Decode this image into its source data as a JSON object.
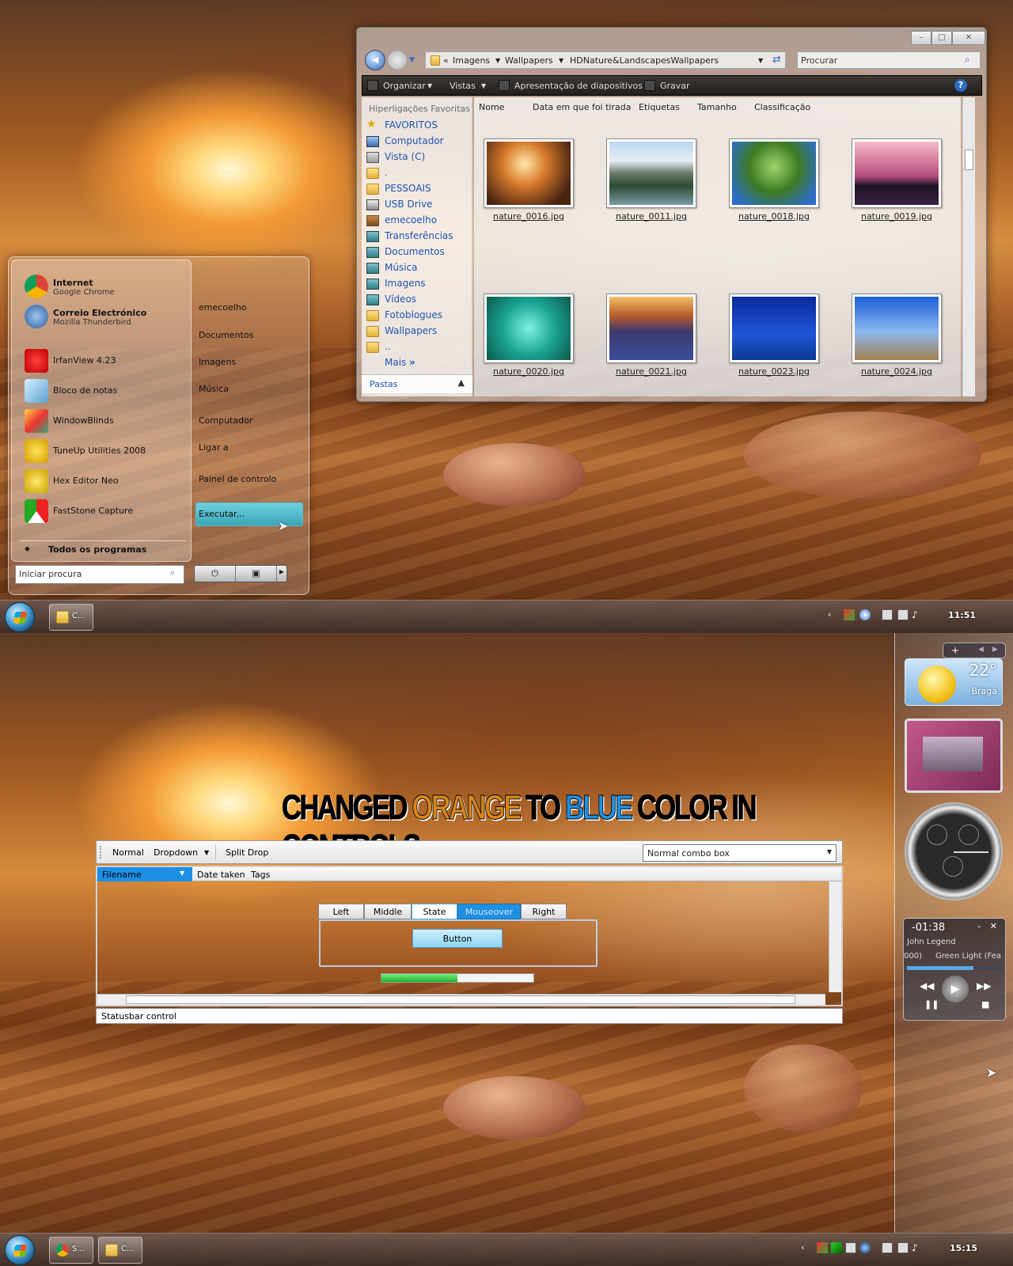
{
  "top": {
    "explorer": {
      "breadcrumb": [
        "Imagens",
        "Wallpapers",
        "HDNature&LandscapesWallpapers"
      ],
      "search_placeholder": "Procurar",
      "toolbar": {
        "organize": "Organizar",
        "views": "Vistas",
        "slideshow": "Apresentação de diapositivos",
        "burn": "Gravar"
      },
      "nav_header": "Hiperligações Favoritas",
      "nav_items": [
        "FAVORITOS",
        "Computador",
        "Vista (C)",
        ".",
        "PESSOAIS",
        "USB Drive",
        "emecoelho",
        "Transferências",
        "Documentos",
        "Música",
        "Imagens",
        "Vídeos",
        "Fotoblogues",
        "Wallpapers",
        ".."
      ],
      "nav_more": "Mais",
      "nav_more_arrow": "»",
      "folders_label": "Pastas",
      "columns": [
        "Nome",
        "Data em que foi tirada",
        "Etiquetas",
        "Tamanho",
        "Classificação"
      ],
      "files": [
        "nature_0016.jpg",
        "nature_0011.jpg",
        "nature_0018.jpg",
        "nature_0019.jpg",
        "nature_0020.jpg",
        "nature_0021.jpg",
        "nature_0023.jpg",
        "nature_0024.jpg"
      ]
    },
    "start_menu": {
      "pinned": [
        {
          "title": "Internet",
          "subtitle": "Google Chrome"
        },
        {
          "title": "Correio Electrónico",
          "subtitle": "Mozilla Thunderbird"
        }
      ],
      "recent": [
        "IrfanView 4.23",
        "Bloco de notas",
        "WindowBlinds",
        "TuneUp Utilities 2008",
        "Hex Editor Neo",
        "FastStone Capture"
      ],
      "all_programs": "Todos os programas",
      "right_links": [
        "emecoelho",
        "Documentos",
        "Imagens",
        "Música",
        "Computador",
        "Ligar a",
        "Painel de controlo",
        "Executar..."
      ],
      "search_placeholder": "Iniciar procura"
    },
    "taskbar": {
      "buttons": [
        "C..."
      ],
      "clock": "11:51"
    }
  },
  "bottom": {
    "banner": {
      "w1": "CHANGED ",
      "w2": "ORANGE",
      "w3": " TO ",
      "w4": "BLUE",
      "w5": " COLOR IN CONTROLS"
    },
    "colors": {
      "orange": "#d9861a",
      "blue": "#1f8fe0"
    },
    "toolbar": {
      "normal": "Normal",
      "dropdown": "Dropdown",
      "split": "Split Drop",
      "combo": "Normal combo box"
    },
    "list_headers": [
      "Filename",
      "Date taken",
      "Tags"
    ],
    "segments": [
      "Left",
      "Middle",
      "State",
      "Mouseover",
      "Right"
    ],
    "button": "Button",
    "progress": 0.5,
    "statusbar": "Statusbar control",
    "sidebar": {
      "weather": {
        "temp": "22°",
        "city": "Braga"
      },
      "media": {
        "time": "-01:38",
        "artist": "John Legend",
        "track": "Green Light (Fea",
        "counter": "000)"
      }
    },
    "taskbar": {
      "buttons": [
        "S...",
        "C..."
      ],
      "clock": "15:15"
    }
  }
}
